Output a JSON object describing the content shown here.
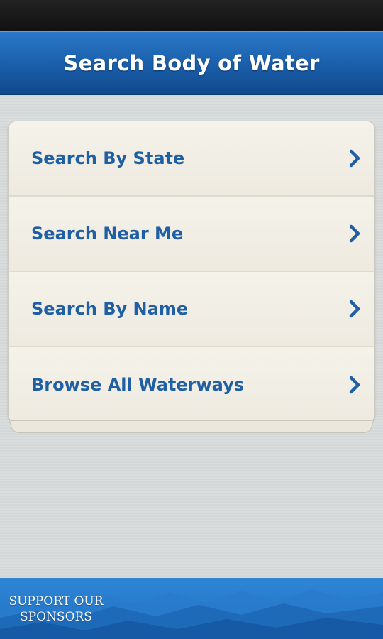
{
  "header": {
    "title": "Search Body of Water"
  },
  "menu": {
    "items": [
      {
        "label": "Search By State",
        "icon": "chevron-right-icon"
      },
      {
        "label": "Search Near Me",
        "icon": "chevron-right-icon"
      },
      {
        "label": "Search By Name",
        "icon": "chevron-right-icon"
      },
      {
        "label": "Browse All Waterways",
        "icon": "chevron-right-icon"
      }
    ]
  },
  "footer": {
    "line1": "SUPPORT OUR",
    "line2": "SPONSORS"
  },
  "colors": {
    "header_blue": "#1a5eaa",
    "label_blue": "#1f5fa3",
    "footer_blue": "#1e6fc0",
    "card_bg": "#f1ede4",
    "page_bg": "#d8dbdb"
  }
}
